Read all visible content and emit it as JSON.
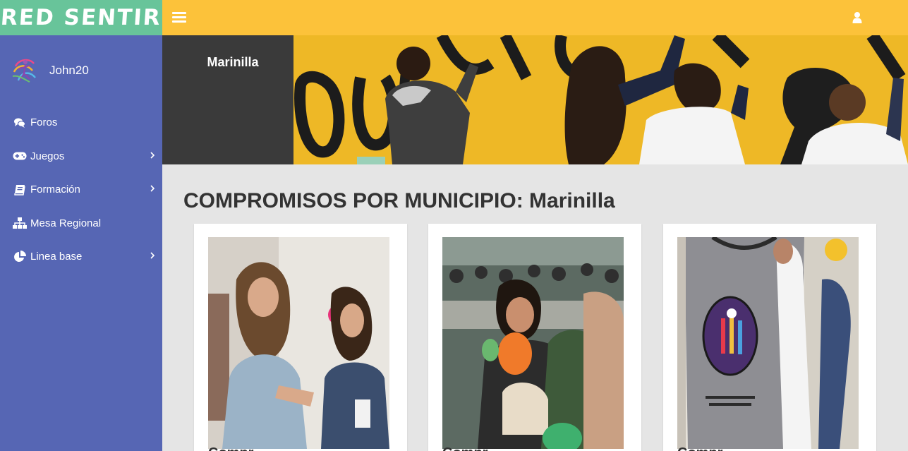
{
  "logo": {
    "text": "RED SENTIR"
  },
  "sidebar": {
    "user": {
      "name": "John20"
    },
    "items": [
      {
        "label": "Foros",
        "icon": "comments-icon",
        "has_submenu": false
      },
      {
        "label": "Juegos",
        "icon": "gamepad-icon",
        "has_submenu": true
      },
      {
        "label": "Formación",
        "icon": "book-icon",
        "has_submenu": true
      },
      {
        "label": "Mesa Regional",
        "icon": "sitemap-icon",
        "has_submenu": false
      },
      {
        "label": "Linea base",
        "icon": "pie-chart-icon",
        "has_submenu": true
      }
    ]
  },
  "header": {
    "municipality": "Marinilla"
  },
  "main": {
    "title": "COMPROMISOS POR MUNICIPIO: Marinilla",
    "cards": [
      {
        "caption": "Compr"
      },
      {
        "caption": "Compr"
      },
      {
        "caption": "Compr"
      }
    ]
  },
  "colors": {
    "logo_bg": "#68c49a",
    "topbar_bg": "#fcc23a",
    "sidebar_bg": "#5666b4",
    "muni_bg": "#3a3a3a",
    "content_bg": "#e5e5e5"
  }
}
